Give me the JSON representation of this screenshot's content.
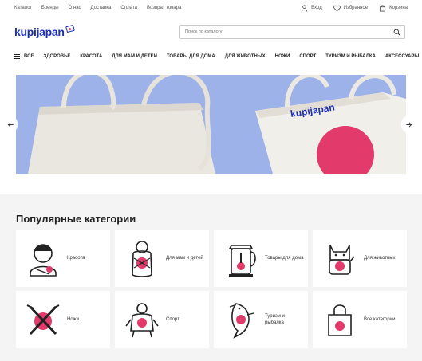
{
  "topbar": {
    "links": [
      "Каталог",
      "Бренды",
      "О нас",
      "Доставка",
      "Оплата",
      "Возврат товара"
    ],
    "login": "Вход",
    "favorites": "Избранное",
    "cart": "Корзина"
  },
  "header": {
    "logo_text": "kupijapan",
    "search_placeholder": "Поиск по каталогу"
  },
  "nav": {
    "items": [
      "Все",
      "Здоровье",
      "Красота",
      "Для мам и детей",
      "Товары для дома",
      "Для животных",
      "Ножи",
      "Спорт",
      "Туризм и рыбалка",
      "Аксессуары"
    ]
  },
  "hero": {
    "bag_logo": "kupijapan"
  },
  "categories": {
    "title": "Популярные категории",
    "items": [
      {
        "label": "Красота",
        "icon": "geisha-icon"
      },
      {
        "label": "Для мам и детей",
        "icon": "baby-icon"
      },
      {
        "label": "Товары для дома",
        "icon": "kettle-icon"
      },
      {
        "label": "Для животных",
        "icon": "lucky-cat-icon"
      },
      {
        "label": "Ножи",
        "icon": "knives-icon"
      },
      {
        "label": "Спорт",
        "icon": "sumo-icon"
      },
      {
        "label": "Туризм и рыбалка",
        "icon": "koi-fish-icon"
      },
      {
        "label": "Все категории",
        "icon": "shopping-bag-icon"
      }
    ]
  },
  "colors": {
    "brand_blue": "#1d2fb5",
    "accent_pink": "#e23a6b",
    "hero_bg": "#9ab0e6"
  }
}
